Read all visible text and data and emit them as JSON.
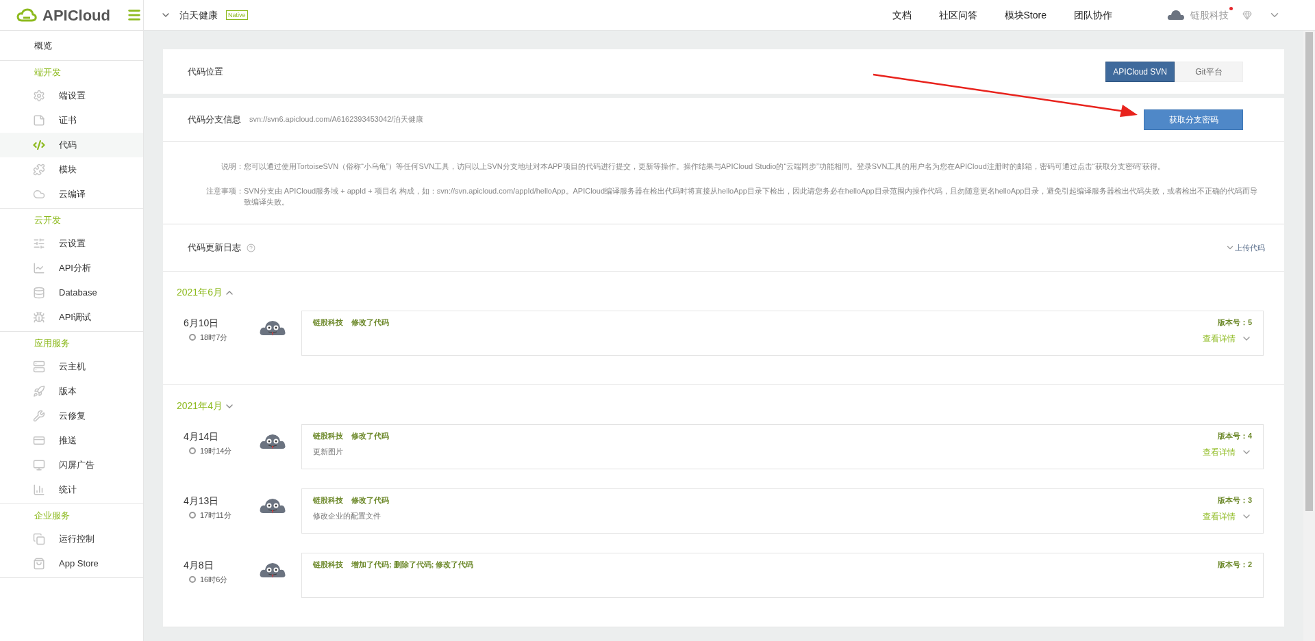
{
  "logo": {
    "text": "APICloud"
  },
  "topbar": {
    "project": "泊天健康",
    "badge": "Native",
    "nav": [
      "文档",
      "社区问答",
      "模块Store",
      "团队协作"
    ],
    "user": "链股科技",
    "notification": true
  },
  "sidebar": {
    "overview": {
      "label": "概览",
      "selected": false
    },
    "groups": [
      {
        "title": "端开发",
        "items": [
          {
            "label": "端设置",
            "selected": false
          },
          {
            "label": "证书",
            "selected": false
          },
          {
            "label": "代码",
            "selected": true
          },
          {
            "label": "模块",
            "selected": false
          },
          {
            "label": "云编译",
            "selected": false
          }
        ]
      },
      {
        "title": "云开发",
        "items": [
          {
            "label": "云设置",
            "selected": false
          },
          {
            "label": "API分析",
            "selected": false
          },
          {
            "label": "Database",
            "selected": false
          },
          {
            "label": "API调试",
            "selected": false
          }
        ]
      },
      {
        "title": "应用服务",
        "items": [
          {
            "label": "云主机",
            "selected": false
          },
          {
            "label": "版本",
            "selected": false
          },
          {
            "label": "云修复",
            "selected": false
          },
          {
            "label": "推送",
            "selected": false
          },
          {
            "label": "闪屏广告",
            "selected": false
          },
          {
            "label": "统计",
            "selected": false
          }
        ]
      },
      {
        "title": "企业服务",
        "items": [
          {
            "label": "运行控制",
            "selected": false
          },
          {
            "label": "App Store",
            "selected": false
          }
        ]
      }
    ]
  },
  "code_location": {
    "title": "代码位置",
    "options": [
      {
        "label": "APICloud SVN",
        "selected": true
      },
      {
        "label": "Git平台",
        "selected": false
      }
    ]
  },
  "branch_info": {
    "title": "代码分支信息",
    "url": "svn://svn6.apicloud.com/A6162393453042/泊天健康",
    "button": "获取分支密码"
  },
  "notes": [
    {
      "label": "说明：",
      "text": "您可以通过使用TortoiseSVN（俗称“小乌龟”）等任何SVN工具，访问以上SVN分支地址对本APP项目的代码进行提交，更新等操作。操作结果与APICloud Studio的“云端同步”功能相同。登录SVN工具的用户名为您在APICloud注册时的邮箱，密码可通过点击“获取分支密码”获得。"
    },
    {
      "label": "注意事项：",
      "text": "SVN分支由 APICloud服务域 + appId + 项目名 构成，如：svn://svn.apicloud.com/appId/helloApp。APICloud编译服务器在检出代码时将直接从helloApp目录下检出，因此请您务必在helloApp目录范围内操作代码，且勿随意更名helloApp目录，避免引起编译服务器检出代码失败，或者检出不正确的代码而导致编译失败。"
    }
  ],
  "log": {
    "title": "代码更新日志",
    "upload": "上传代码",
    "months": [
      {
        "title": "2021年6月",
        "expanded": true,
        "entries": [
          {
            "date": "6月10日",
            "time": "18时7分",
            "author": "链股科技",
            "action": "修改了代码",
            "version_label": "版本号：",
            "version": "5",
            "details": "查看详情"
          }
        ]
      },
      {
        "title": "2021年4月",
        "expanded": false,
        "entries": [
          {
            "date": "4月14日",
            "time": "19时14分",
            "author": "链股科技",
            "action": "修改了代码",
            "description": "更新图片",
            "version_label": "版本号：",
            "version": "4",
            "details": "查看详情"
          },
          {
            "date": "4月13日",
            "time": "17时11分",
            "author": "链股科技",
            "action": "修改了代码",
            "description": "修改企业的配置文件",
            "version_label": "版本号：",
            "version": "3",
            "details": "查看详情"
          },
          {
            "date": "4月8日",
            "time": "16时6分",
            "author": "链股科技",
            "action": "增加了代码; 删除了代码; 修改了代码",
            "version_label": "版本号：",
            "version": "2"
          }
        ]
      }
    ]
  }
}
